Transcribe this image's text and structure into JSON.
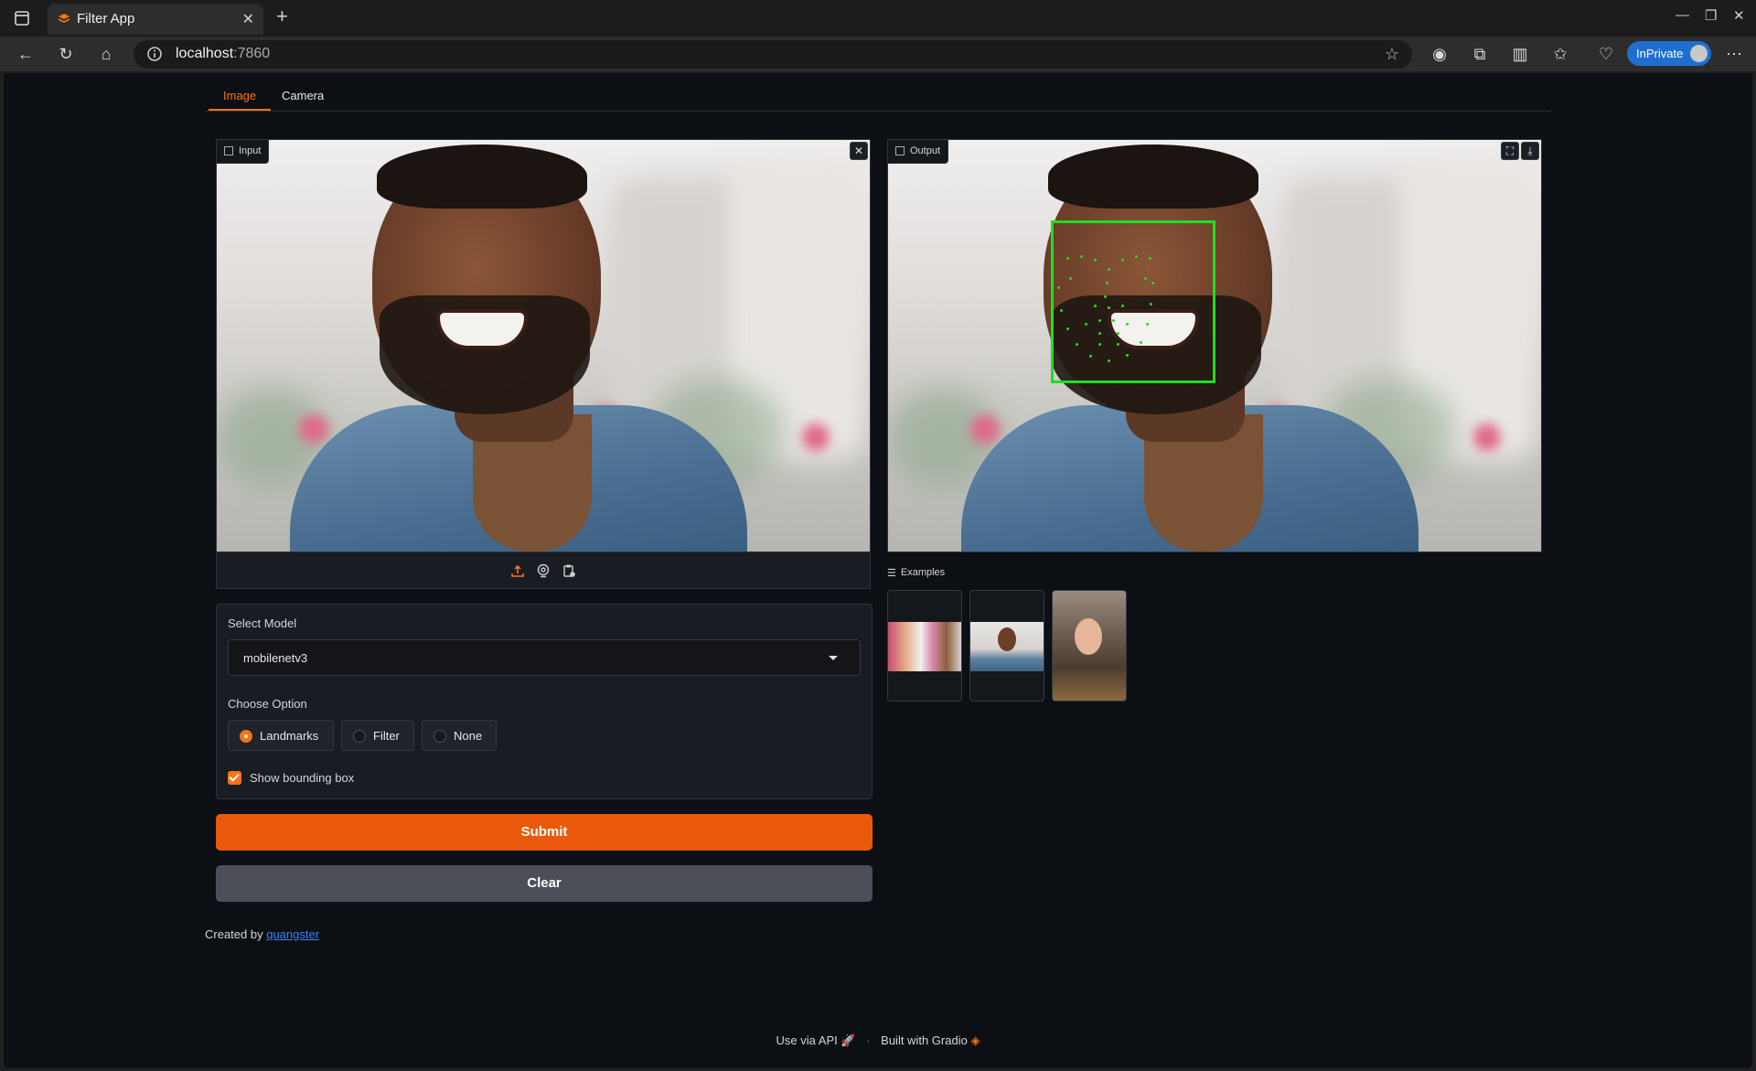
{
  "browser": {
    "tab_title": "Filter App",
    "url_host": "localhost",
    "url_port": ":7860",
    "inprivate_label": "InPrivate"
  },
  "app": {
    "tabs": [
      {
        "label": "Image",
        "active": true
      },
      {
        "label": "Camera",
        "active": false
      }
    ],
    "input_label": "Input",
    "output_label": "Output",
    "examples_label": "Examples",
    "select_model_label": "Select Model",
    "select_model_value": "mobilenetv3",
    "choose_option_label": "Choose Option",
    "options": [
      {
        "label": "Landmarks",
        "selected": true
      },
      {
        "label": "Filter",
        "selected": false
      },
      {
        "label": "None",
        "selected": false
      }
    ],
    "show_bbox_label": "Show bounding box",
    "show_bbox_checked": true,
    "submit_label": "Submit",
    "clear_label": "Clear",
    "created_by_prefix": "Created by",
    "created_by_link": "quangster",
    "footer_api": "Use via API",
    "footer_sep": "·",
    "footer_built": "Built with Gradio"
  },
  "colors": {
    "accent": "#f97316",
    "submit": "#ea580c",
    "landmark": "#1ee01e"
  }
}
